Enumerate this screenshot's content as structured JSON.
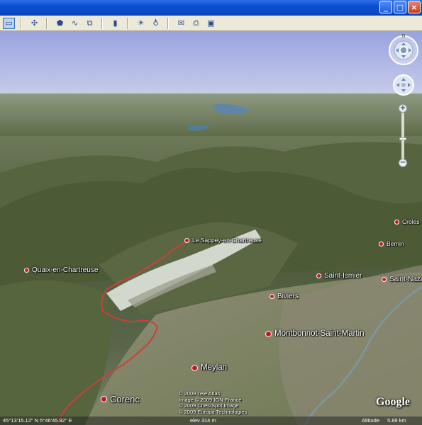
{
  "window": {
    "buttons": {
      "minimize": "_",
      "maximize": "□",
      "close": "×"
    }
  },
  "toolbar": {
    "items": [
      {
        "icon": "sidebar-icon",
        "glyph": "▭"
      },
      {
        "icon": "placemark-icon",
        "glyph": "✣"
      },
      {
        "icon": "polygon-icon",
        "glyph": "⬟"
      },
      {
        "icon": "path-icon",
        "glyph": "∿"
      },
      {
        "icon": "image-overlay-icon",
        "glyph": "⧉"
      },
      {
        "icon": "tour-icon",
        "glyph": "▮"
      },
      {
        "icon": "sun-icon",
        "glyph": "☀"
      },
      {
        "icon": "planet-icon",
        "glyph": "♁"
      },
      {
        "icon": "email-icon",
        "glyph": "✉"
      },
      {
        "icon": "print-icon",
        "glyph": "⎙"
      },
      {
        "icon": "maps-icon",
        "glyph": "▣"
      }
    ]
  },
  "map": {
    "places": [
      {
        "name": "Le Sappey-en-Chartreuse",
        "size": "sm"
      },
      {
        "name": "Croles",
        "size": "sm"
      },
      {
        "name": "Bernin",
        "size": "sm"
      },
      {
        "name": "Quaix-en-Chartreuse",
        "size": "md"
      },
      {
        "name": "Saint-Ismier",
        "size": "md"
      },
      {
        "name": "Saint-Naza",
        "size": "md"
      },
      {
        "name": "Biviers",
        "size": "md"
      },
      {
        "name": "Montbonnot-Saint-Martin",
        "size": "lg"
      },
      {
        "name": "Meylan",
        "size": "lg"
      },
      {
        "name": "Corenc",
        "size": "xl"
      }
    ],
    "copyright": [
      "© 2009 Tele Atlas",
      "Image © 2009 IGN-France",
      "© 2009 Cnes/Spot Image",
      "© 2009 Europa Technologies"
    ],
    "logo": "Google",
    "status": {
      "coordinates": "45°13'15.12\" N    5°46'45.92\" E",
      "elevation": "elev   314 m",
      "altitude_label": "Altitude",
      "altitude_value": "5.89 km"
    }
  },
  "nav": {
    "north_label": "N",
    "zoom_in": "+",
    "zoom_out": "−",
    "zoom_level": 0.55
  },
  "colors": {
    "titlebar": "#0a4fd0",
    "placemark": "#c0182a",
    "track": "#c8423a"
  }
}
